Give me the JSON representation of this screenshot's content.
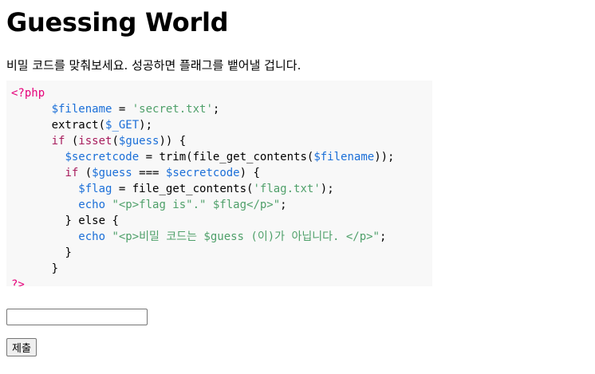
{
  "page": {
    "title": "Guessing World",
    "description": "비밀 코드를 맞춰보세요. 성공하면 플래그를 뱉어낼 겁니다."
  },
  "code": {
    "open_tag": "<?php",
    "close_tag": "?>",
    "lines": {
      "l1_var": "$filename",
      "l1_op": " = ",
      "l1_str": "'secret.txt'",
      "l1_end": ";",
      "l2_fn": "extract(",
      "l2_var": "$_GET",
      "l2_end": ");",
      "l3_kw": "if",
      "l3_a": " (",
      "l3_fn": "isset",
      "l3_b": "(",
      "l3_var": "$guess",
      "l3_end": ")) {",
      "l4_var": "$secretcode",
      "l4_a": " = ",
      "l4_fn": "trim(file_get_contents(",
      "l4_var2": "$filename",
      "l4_end": "));",
      "l5_kw": "if",
      "l5_a": " (",
      "l5_var": "$guess",
      "l5_op": " === ",
      "l5_var2": "$secretcode",
      "l5_end": ") {",
      "l6_var": "$flag",
      "l6_a": " = ",
      "l6_fn": "file_get_contents(",
      "l6_str": "'flag.txt'",
      "l6_end": ");",
      "l7_echo": "echo",
      "l7_str": " \"<p>flag is\".\" $flag</p>\"",
      "l7_end": ";",
      "l8": "} else {",
      "l9_echo": "echo",
      "l9_str": " \"<p>비밀 코드는 $guess (이)가 아닙니다. </p>\"",
      "l9_end": ";",
      "l10": "}",
      "l11": "}"
    }
  },
  "form": {
    "input_value": "",
    "submit_label": "제출"
  }
}
